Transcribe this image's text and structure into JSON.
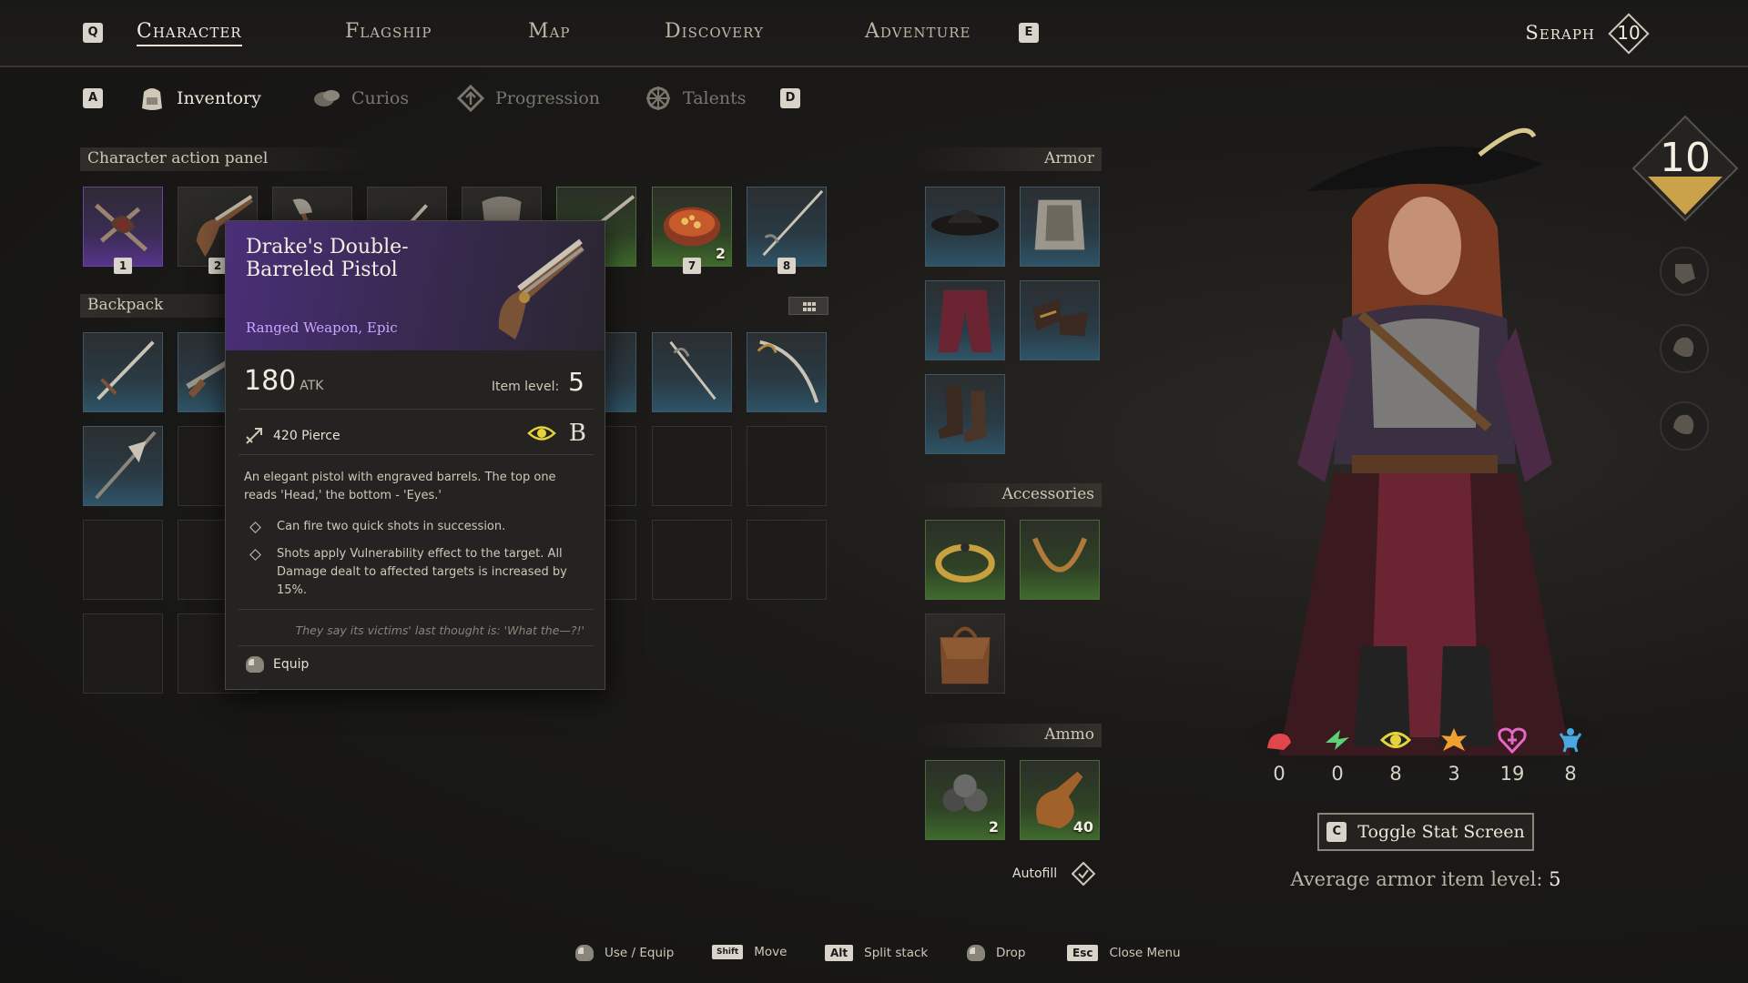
{
  "nav": {
    "left_key": "Q",
    "right_key": "E",
    "tabs": [
      "Character",
      "Flagship",
      "Map",
      "Discovery",
      "Adventure"
    ],
    "active": "Character",
    "player_name": "Seraph",
    "player_level": "10"
  },
  "subnav": {
    "left_key": "A",
    "right_key": "D",
    "tabs": [
      "Inventory",
      "Curios",
      "Progression",
      "Talents"
    ],
    "active": "Inventory"
  },
  "sections": {
    "action_panel": "Character action panel",
    "backpack": "Backpack",
    "armor": "Armor",
    "accessories": "Accessories",
    "ammo": "Ammo"
  },
  "action_slots": [
    {
      "badge": "1",
      "count": "",
      "rarity": "purple"
    },
    {
      "badge": "2",
      "count": "",
      "rarity": "plain"
    },
    {
      "badge": "",
      "count": "",
      "rarity": "plain"
    },
    {
      "badge": "",
      "count": "",
      "rarity": "plain"
    },
    {
      "badge": "",
      "count": "",
      "rarity": "plain"
    },
    {
      "badge": "",
      "count": "",
      "rarity": "green"
    },
    {
      "badge": "7",
      "count": "2",
      "rarity": "green"
    },
    {
      "badge": "8",
      "count": "",
      "rarity": "blue"
    }
  ],
  "tooltip": {
    "name": "Drake's Double-Barreled Pistol",
    "type": "Ranged Weapon, Epic",
    "attack": "180",
    "attack_label": "ATK",
    "item_level_label": "Item level:",
    "item_level": "5",
    "pierce": "420 Pierce",
    "grade": "B",
    "description": "An elegant pistol with engraved barrels. The top one reads 'Head,' the bottom - 'Eyes.'",
    "perk_1": "Can fire two quick shots in succession.",
    "perk_2": "Shots apply Vulnerability effect to the target. All Damage dealt to affected targets is increased by 15%.",
    "flavor": "They say its victims' last thought is: 'What the—?!'",
    "equip_label": "Equip"
  },
  "ammo": {
    "cannonballs_count": "2",
    "powder_count": "40",
    "autofill_label": "Autofill"
  },
  "stats": [
    {
      "icon": "strength-icon",
      "value": "0",
      "color": "#e0474c"
    },
    {
      "icon": "agility-icon",
      "value": "0",
      "color": "#5fd07a"
    },
    {
      "icon": "perception-icon",
      "value": "8",
      "color": "#e6d23a"
    },
    {
      "icon": "power-icon",
      "value": "3",
      "color": "#f0a030"
    },
    {
      "icon": "vitality-icon",
      "value": "19",
      "color": "#e766c8"
    },
    {
      "icon": "spirit-icon",
      "value": "8",
      "color": "#4aa8e0"
    }
  ],
  "toggle_stat": {
    "key": "C",
    "label": "Toggle Stat Screen"
  },
  "avg_armor": {
    "label": "Average armor item level:",
    "value": "5"
  },
  "big_level": "10",
  "footer": {
    "use_equip": "Use / Equip",
    "move_key": "Shift",
    "move": "Move",
    "split_key": "Alt",
    "split": "Split stack",
    "drop": "Drop",
    "close_key": "Esc",
    "close": "Close Menu"
  }
}
